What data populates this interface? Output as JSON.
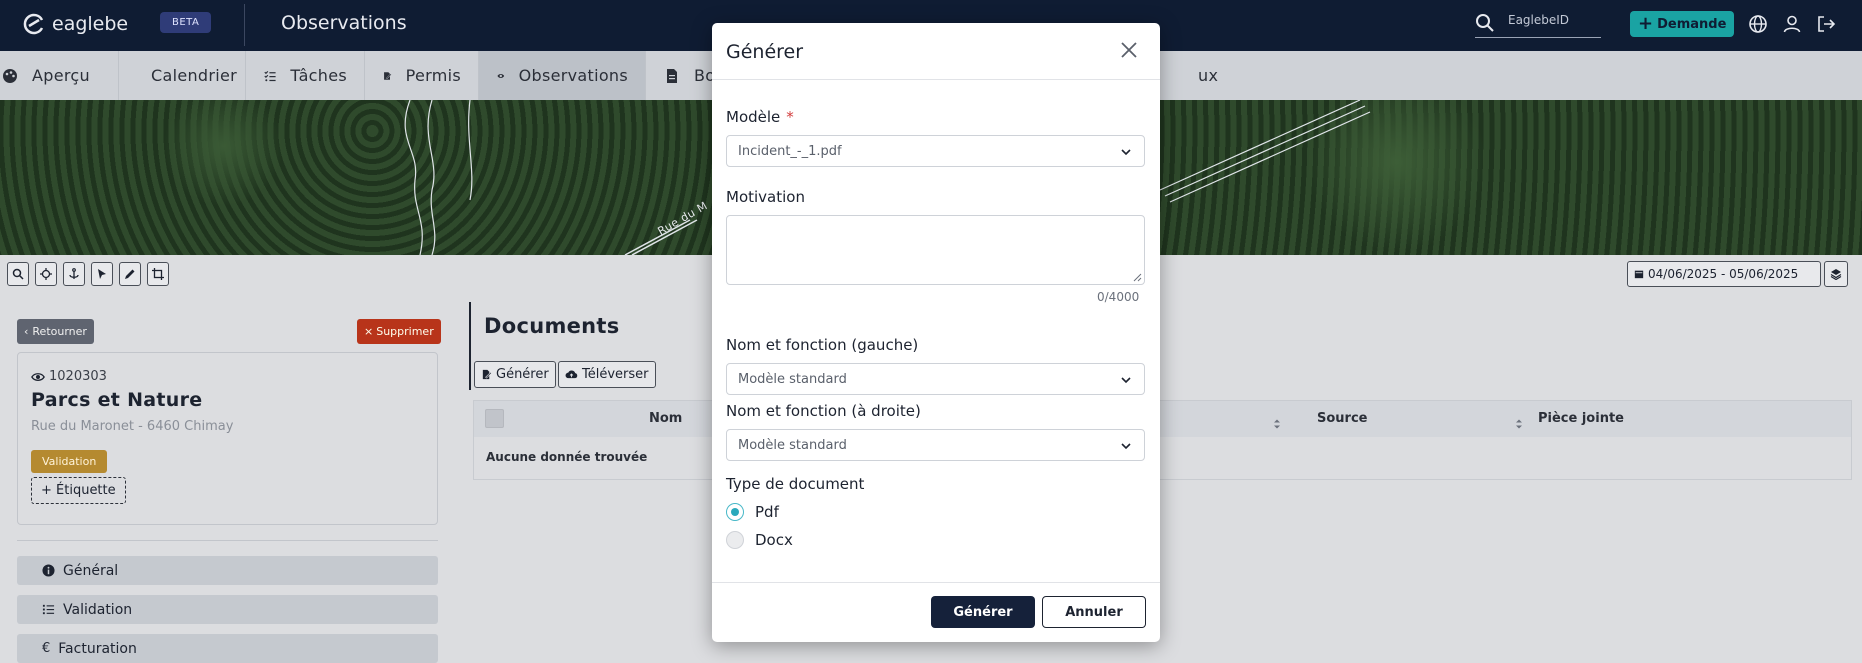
{
  "header": {
    "logo_text": "eaglebe",
    "beta_badge": "BETA",
    "title": "Observations",
    "search_placeholder": "EaglebeID",
    "demande_label": "Demande"
  },
  "tabs": [
    {
      "label": "Aperçu",
      "icon": "palette-icon"
    },
    {
      "label": "Calendrier",
      "icon": "calendar-icon"
    },
    {
      "label": "Tâches",
      "icon": "tasks-icon"
    },
    {
      "label": "Permis",
      "icon": "permit-icon"
    },
    {
      "label": "Observations",
      "icon": "eye-icon",
      "active": true
    },
    {
      "label": "Bo",
      "icon": "document-icon"
    },
    {
      "label": "ux",
      "icon": ""
    }
  ],
  "map": {
    "road_label": "Rue du M"
  },
  "toolbar": {
    "date_range": "04/06/2025 - 05/06/2025"
  },
  "left_panel": {
    "back_label": "Retourner",
    "delete_label": "Supprimer",
    "reference": "1020303",
    "title": "Parcs et Nature",
    "address": "Rue du Maronet - 6460 Chimay",
    "status_badge": "Validation",
    "add_tag_label": "+ Étiquette",
    "sections": [
      "Général",
      "Validation",
      "Facturation"
    ]
  },
  "documents": {
    "title": "Documents",
    "generate_label": "Générer",
    "upload_label": "Téléverser",
    "columns": [
      "Nom",
      "Source",
      "Pièce jointe"
    ],
    "empty_text": "Aucune donnée trouvée"
  },
  "modal": {
    "title": "Générer",
    "model_label": "Modèle",
    "model_value": "Incident_-_1.pdf",
    "motivation_label": "Motivation",
    "motivation_value": "",
    "counter": "0/4000",
    "left_name_label": "Nom et fonction (gauche)",
    "left_name_value": "Modèle standard",
    "right_name_label": "Nom et fonction (à droite)",
    "right_name_value": "Modèle standard",
    "doc_type_label": "Type de document",
    "doc_types": [
      "Pdf",
      "Docx"
    ],
    "doc_type_selected": "Pdf",
    "generate_button": "Générer",
    "cancel_button": "Annuler"
  },
  "colors": {
    "header_bg": "#0f1c33",
    "accent_teal": "#1aa3a3",
    "badge_gold": "#b58a30",
    "danger_red": "#b8341a"
  }
}
